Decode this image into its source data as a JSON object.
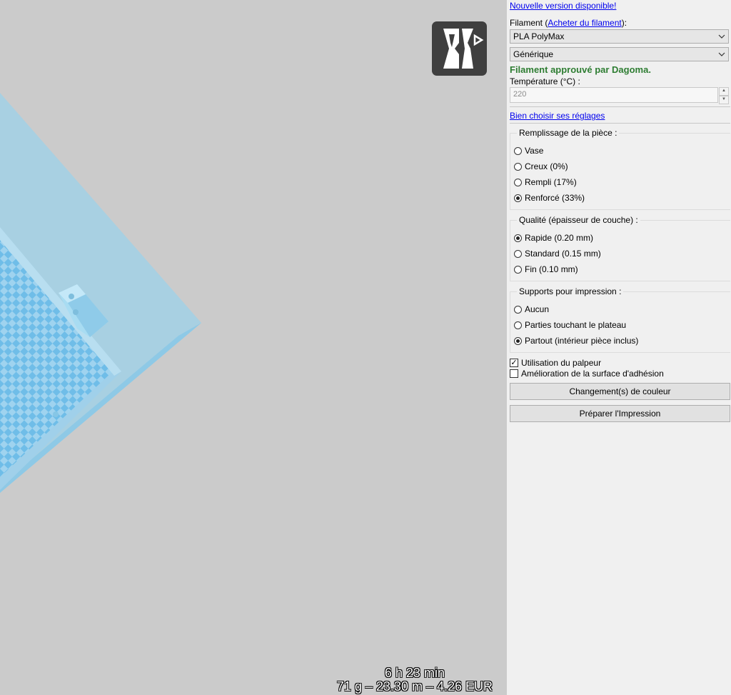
{
  "viewport": {
    "stats_time": "6 h 23 min",
    "stats_material": "71 g – 23.30 m – 4.26 EUR",
    "logo_icon": "dagoma-logo-icon",
    "colors": {
      "plate": "#a6cee0",
      "plate_edge": "#8cc8e4",
      "checker_a": "#7fc3e8",
      "checker_b": "#9fd3ef",
      "background": "#cbcbcb"
    }
  },
  "panel": {
    "update_link": "Nouvelle version disponible!",
    "filament_label_prefix": "Filament (",
    "filament_buy_link": "Acheter du filament",
    "filament_label_suffix": "):",
    "filament_select": "PLA PolyMax",
    "color_select": "Générique",
    "approved_text": "Filament approuvé par Dagoma.",
    "temperature_label": "Température (°C) :",
    "temperature_value": "220",
    "settings_link": "Bien choisir ses réglages",
    "infill": {
      "title": "Remplissage de la pièce :",
      "options": [
        "Vase",
        "Creux (0%)",
        "Rempli (17%)",
        "Renforcé (33%)"
      ],
      "selected": "Renforcé (33%)"
    },
    "quality": {
      "title": "Qualité (épaisseur de couche) :",
      "options": [
        "Rapide (0.20 mm)",
        "Standard (0.15 mm)",
        "Fin (0.10 mm)"
      ],
      "selected": "Rapide (0.20 mm)"
    },
    "supports": {
      "title": "Supports pour impression :",
      "options": [
        "Aucun",
        "Parties touchant le plateau",
        "Partout (intérieur pièce inclus)"
      ],
      "selected": "Partout (intérieur pièce inclus)"
    },
    "probe_checkbox": {
      "label": "Utilisation du palpeur",
      "checked": true
    },
    "adhesion_checkbox": {
      "label": "Amélioration de la surface d'adhésion",
      "checked": false
    },
    "color_change_button": "Changement(s) de couleur",
    "prepare_button": "Préparer l'Impression",
    "approved_color": "#2e7d32"
  }
}
